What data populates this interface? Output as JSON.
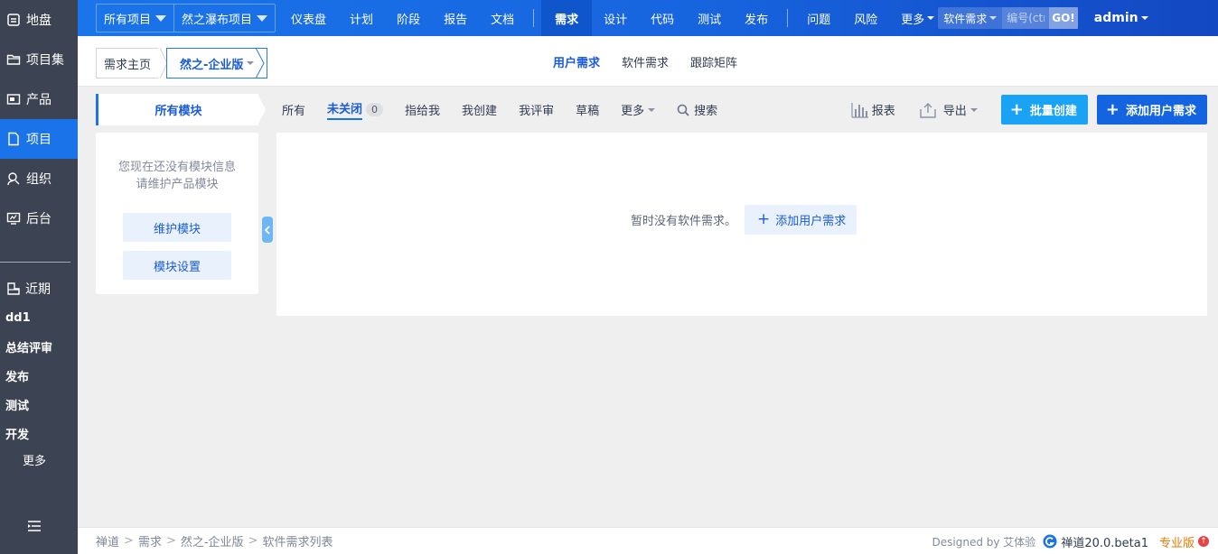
{
  "sidebar": {
    "items": [
      {
        "label": "地盘",
        "icon": "home-icon"
      },
      {
        "label": "项目集",
        "icon": "folder-icon"
      },
      {
        "label": "产品",
        "icon": "product-icon"
      },
      {
        "label": "项目",
        "icon": "project-icon",
        "active": true
      },
      {
        "label": "组织",
        "icon": "user-icon"
      },
      {
        "label": "后台",
        "icon": "admin-icon"
      }
    ],
    "recent_label": "近期",
    "recent": [
      "dd1",
      "总结评审",
      "发布",
      "测试",
      "开发"
    ],
    "more": "更多"
  },
  "topbar": {
    "crumb_all": "所有项目",
    "crumb_project": "然之瀑布项目",
    "nav": [
      "仪表盘",
      "计划",
      "阶段",
      "报告",
      "文档"
    ],
    "nav_active": "需求",
    "nav2": [
      "设计",
      "代码",
      "测试",
      "发布"
    ],
    "nav3": [
      "问题",
      "风险"
    ],
    "more": "更多",
    "search_type": "软件需求",
    "search_placeholder": "编号(ctrl",
    "go": "GO!",
    "user": "admin"
  },
  "subheader": {
    "home": "需求主页",
    "product": "然之-企业版",
    "tabs": [
      "用户需求",
      "软件需求",
      "跟踪矩阵"
    ],
    "active_tab": 0
  },
  "toolbar": {
    "module_head": "所有模块",
    "filters": [
      "所有",
      "未关闭",
      "指给我",
      "我创建",
      "我评审",
      "草稿"
    ],
    "active_filter": 1,
    "unclosed_count": "0",
    "more": "更多",
    "search": "搜索",
    "report": "报表",
    "export": "导出",
    "batch_create": "批量创建",
    "add_requirement": "添加用户需求"
  },
  "module_panel": {
    "msg_line1": "您现在还没有模块信息",
    "msg_line2": "请维护产品模块",
    "maintain": "维护模块",
    "settings": "模块设置"
  },
  "main": {
    "empty_text": "暂时没有软件需求。",
    "add_button": "添加用户需求"
  },
  "footer": {
    "crumbs": [
      "禅道",
      "需求",
      "然之-企业版",
      "软件需求列表"
    ],
    "designed_by": "Designed by 艾体验",
    "version": "禅道20.0.beta1",
    "edition": "专业版"
  },
  "colors": {
    "sidebar_bg": "#3c4353",
    "primary": "#1463e0",
    "accent": "#1aa3f5",
    "link": "#1a5bd6"
  }
}
